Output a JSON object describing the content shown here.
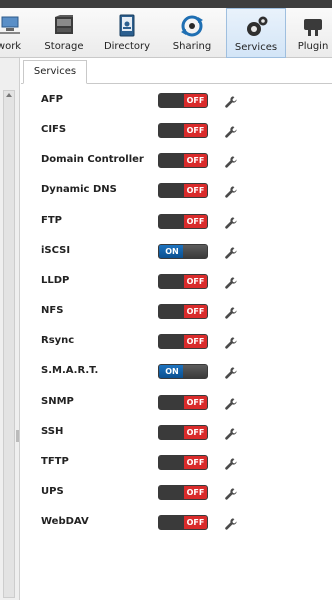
{
  "toolbar": {
    "items": [
      {
        "label": "work",
        "icon": "network-icon"
      },
      {
        "label": "Storage",
        "icon": "storage-icon"
      },
      {
        "label": "Directory",
        "icon": "directory-icon"
      },
      {
        "label": "Sharing",
        "icon": "sharing-icon"
      },
      {
        "label": "Services",
        "icon": "services-icon",
        "active": true
      },
      {
        "label": "Plugin",
        "icon": "plugins-icon"
      }
    ]
  },
  "tab": {
    "label": "Services"
  },
  "toggle_labels": {
    "on": "ON",
    "off": "OFF"
  },
  "colors": {
    "off": "#d92b2b",
    "on": "#1d73bf"
  },
  "services": [
    {
      "name": "AFP",
      "state": "OFF"
    },
    {
      "name": "CIFS",
      "state": "OFF"
    },
    {
      "name": "Domain Controller",
      "state": "OFF"
    },
    {
      "name": "Dynamic DNS",
      "state": "OFF"
    },
    {
      "name": "FTP",
      "state": "OFF"
    },
    {
      "name": "iSCSI",
      "state": "ON"
    },
    {
      "name": "LLDP",
      "state": "OFF"
    },
    {
      "name": "NFS",
      "state": "OFF"
    },
    {
      "name": "Rsync",
      "state": "OFF"
    },
    {
      "name": "S.M.A.R.T.",
      "state": "ON"
    },
    {
      "name": "SNMP",
      "state": "OFF"
    },
    {
      "name": "SSH",
      "state": "OFF"
    },
    {
      "name": "TFTP",
      "state": "OFF"
    },
    {
      "name": "UPS",
      "state": "OFF"
    },
    {
      "name": "WebDAV",
      "state": "OFF"
    }
  ]
}
